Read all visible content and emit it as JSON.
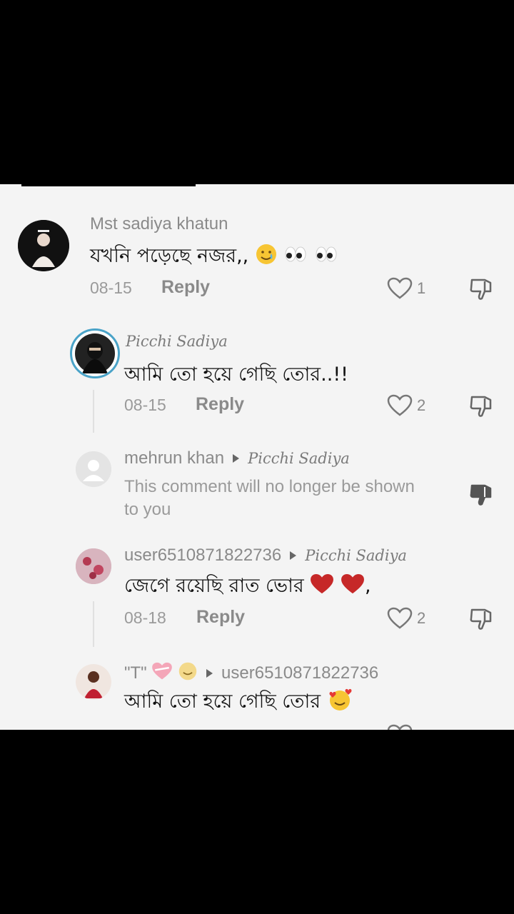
{
  "comments": [
    {
      "username": "Mst sadiya khatun",
      "text": "যখনি পড়েছে নজর,,",
      "date": "08-15",
      "reply_label": "Reply",
      "likes": "1"
    },
    {
      "username": "Picchi Sadiya",
      "text": "আমি তো হয়ে গেছি তোর..!!",
      "date": "08-15",
      "reply_label": "Reply",
      "likes": "2"
    },
    {
      "username": "mehrun khan",
      "reply_to": "Picchi Sadiya",
      "text": "This comment will no longer be shown to you"
    },
    {
      "username": "user6510871822736",
      "reply_to": "Picchi Sadiya",
      "text": "জেগে রয়েছি রাত ভোর",
      "date": "08-18",
      "reply_label": "Reply",
      "likes": "2"
    },
    {
      "username": "\"T\"",
      "reply_to": "user6510871822736",
      "text": "আমি তো হয়ে গেছি তোর"
    }
  ],
  "colors": {
    "background": "#000000",
    "panel": "#f4f4f4",
    "heart": "#c62828",
    "avatar_ring": "#4aa3c8"
  },
  "icons": [
    "heart-outline-icon",
    "thumbs-down-icon",
    "thumbs-down-filled-icon",
    "play-arrow-icon"
  ]
}
